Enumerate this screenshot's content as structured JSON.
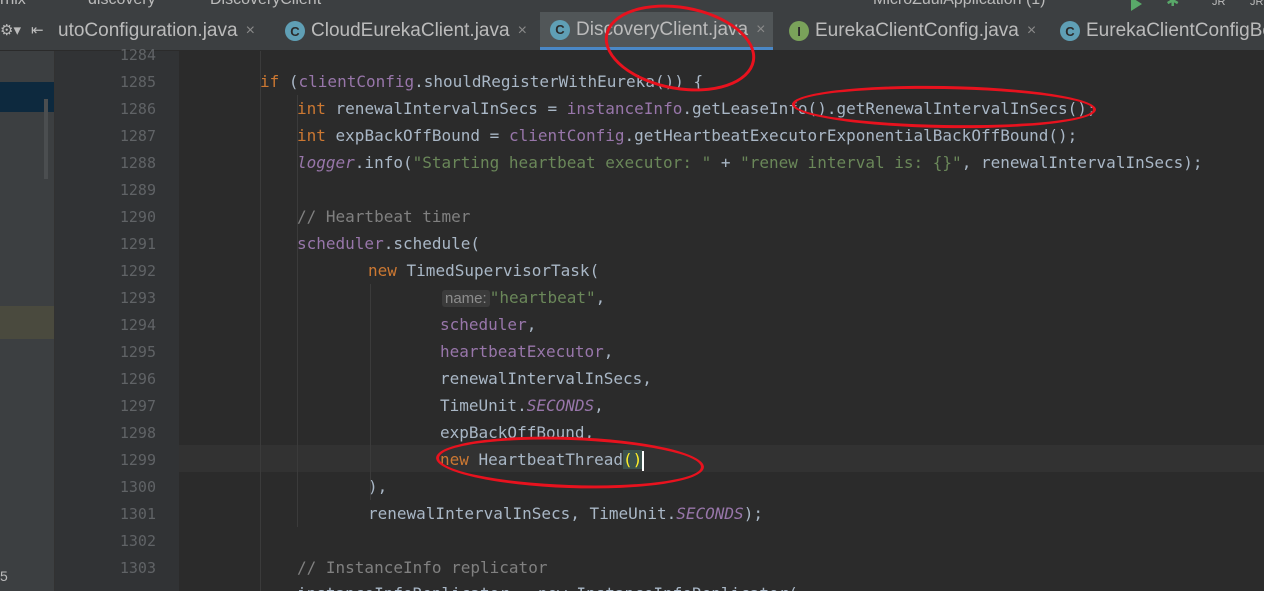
{
  "breadcrumb": {
    "segments": [
      "rnix",
      "discovery",
      "DiscoveryClient"
    ],
    "run_config": "MicroZuulApplication (1)",
    "badges": [
      "JR",
      "JR"
    ]
  },
  "tabs": [
    {
      "label": "utoConfiguration.java",
      "icon": "",
      "close": "×"
    },
    {
      "label": "CloudEurekaClient.java",
      "icon": "C",
      "close": "×"
    },
    {
      "label": "DiscoveryClient.java",
      "icon": "C",
      "close": "×",
      "active": true
    },
    {
      "label": "EurekaClientConfig.java",
      "icon": "I",
      "close": "×"
    },
    {
      "label": "EurekaClientConfigBe",
      "icon": "C",
      "close": ""
    }
  ],
  "sidebar": {
    "bottom_number": "5"
  },
  "line_numbers": [
    "1284",
    "1285",
    "1286",
    "1287",
    "1288",
    "1289",
    "1290",
    "1291",
    "1292",
    "1293",
    "1294",
    "1295",
    "1296",
    "1297",
    "1298",
    "1299",
    "1300",
    "1301",
    "1302",
    "1303"
  ],
  "code": {
    "l1285": {
      "k_if": "if",
      "p1": " (",
      "f1": "clientConfig",
      "rest": ".shouldRegisterWithEureka()) {"
    },
    "l1286": {
      "k": "int",
      "a": " renewalIntervalInSecs = ",
      "f": "instanceInfo",
      "b": ".getLeaseInfo().getRenewalIntervalInSecs();"
    },
    "l1287": {
      "k": "int",
      "a": " expBackOffBound = ",
      "f": "clientConfig",
      "b": ".getHeartbeatExecutorExponentialBackOffBound();"
    },
    "l1288": {
      "f": "logger",
      "a": ".info(",
      "s1": "\"Starting heartbeat executor: \"",
      "b": " + ",
      "s2": "\"renew interval is: {}\"",
      "c": ", renewalIntervalInSecs);"
    },
    "l1290": {
      "cmt": "// Heartbeat timer"
    },
    "l1291": {
      "f": "scheduler",
      "a": ".schedule("
    },
    "l1292": {
      "k": "new",
      "a": " TimedSupervisorTask("
    },
    "l1293": {
      "hint": "name:",
      "s": "\"heartbeat\"",
      "a": ","
    },
    "l1294": {
      "f": "scheduler",
      "a": ","
    },
    "l1295": {
      "f": "heartbeatExecutor",
      "a": ","
    },
    "l1296": {
      "a": "renewalIntervalInSecs,"
    },
    "l1297": {
      "a": "TimeUnit.",
      "f": "SECONDS",
      "b": ","
    },
    "l1298": {
      "a": "expBackOffBound,"
    },
    "l1299": {
      "k": "new",
      "a": " HeartbeatThread",
      "p": "()"
    },
    "l1300": {
      "a": "),"
    },
    "l1301": {
      "a": "renewalIntervalInSecs, TimeUnit.",
      "f": "SECONDS",
      "b": ");"
    },
    "l1303": {
      "cmt": "// InstanceInfo replicator"
    },
    "l1304": {
      "a": "instanceInfoReplicator = new InstanceInfoReplicator("
    }
  },
  "colors": {
    "annotation": "#e8121e",
    "keyword": "#cc7832",
    "field": "#9876aa",
    "string": "#6a8759",
    "comment": "#808080",
    "text": "#a9b7c6",
    "background": "#2b2b2b",
    "active_tab_underline": "#4a88c7"
  },
  "icons": [
    "settings-icon",
    "collapse-icon",
    "class-icon",
    "interface-icon",
    "close-icon",
    "run-icon",
    "debug-icon"
  ]
}
